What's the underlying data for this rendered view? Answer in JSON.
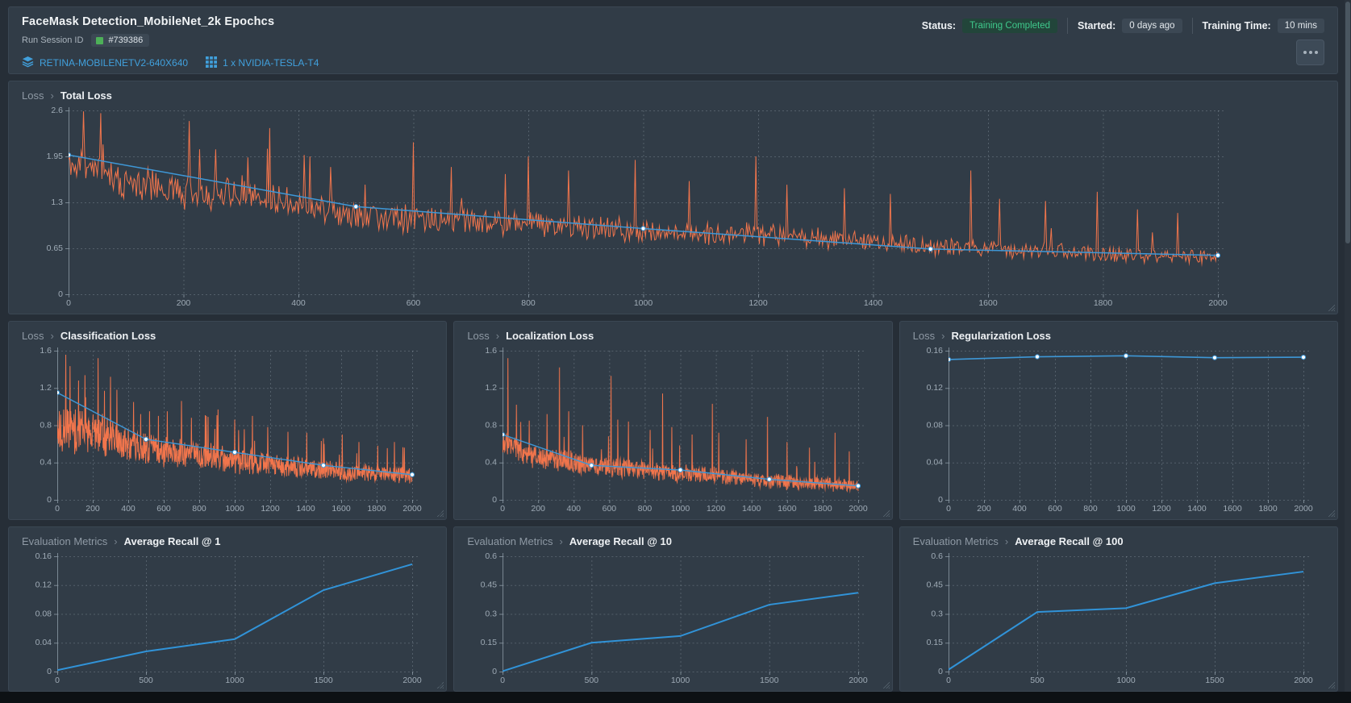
{
  "header": {
    "title": "FaceMask Detection_MobileNet_2k Epochcs",
    "run_session_label": "Run Session ID",
    "run_session_id": "#739386",
    "model_link": "RETINA-MOBILENETV2-640X640",
    "gpu_link": "1 x NVIDIA-TESLA-T4",
    "status_label": "Status:",
    "status_value": "Training Completed",
    "started_label": "Started:",
    "started_value": "0 days ago",
    "training_time_label": "Training Time:",
    "training_time_value": "10 mins"
  },
  "ui": {
    "breadcrumb_separator": "›",
    "colors": {
      "accent_blue": "#41A0DC",
      "raw_orange": "#F1754C",
      "smoothed_blue": "#3E97D6",
      "status_green": "#3FC98C",
      "status_green_bg": "#22453A",
      "badge_bg": "#3C4854",
      "panel_bg": "#313C47",
      "page_bg": "#262E37"
    }
  },
  "chart_data": [
    {
      "id": "total-loss",
      "group": "Loss",
      "title": "Total Loss",
      "type": "line",
      "x_range": [
        0,
        2000
      ],
      "y_range": [
        0,
        2.6
      ],
      "x_ticks": [
        0,
        200,
        400,
        600,
        800,
        1000,
        1200,
        1400,
        1600,
        1800,
        2000
      ],
      "y_ticks": [
        0,
        0.65,
        1.3,
        1.95,
        2.6
      ],
      "raw": {
        "color": "#F1754C",
        "seed": 11,
        "samples": 1000,
        "trend_x": [
          0,
          100,
          200,
          300,
          400,
          500,
          600,
          700,
          800,
          900,
          1000,
          1100,
          1200,
          1300,
          1400,
          1500,
          1600,
          1700,
          1800,
          1900,
          2000
        ],
        "trend_y": [
          1.9,
          1.58,
          1.46,
          1.44,
          1.3,
          1.12,
          1.06,
          1.02,
          1.0,
          0.94,
          0.9,
          0.86,
          0.84,
          0.8,
          0.73,
          0.68,
          0.63,
          0.62,
          0.58,
          0.55,
          0.52
        ],
        "amp": [
          0.3,
          0.28,
          0.28,
          0.3,
          0.26,
          0.22,
          0.22,
          0.22,
          0.2,
          0.2,
          0.18,
          0.18,
          0.18,
          0.16,
          0.16,
          0.15,
          0.14,
          0.14,
          0.13,
          0.13,
          0.12
        ],
        "spikes": [
          [
            25,
            2.6
          ],
          [
            60,
            2.12
          ],
          [
            210,
            2.45
          ],
          [
            255,
            2.05
          ],
          [
            350,
            2.35
          ],
          [
            420,
            1.95
          ],
          [
            455,
            1.8
          ],
          [
            600,
            2.15
          ],
          [
            665,
            1.8
          ],
          [
            760,
            1.7
          ],
          [
            800,
            1.95
          ],
          [
            870,
            1.75
          ],
          [
            985,
            1.9
          ],
          [
            1080,
            1.6
          ],
          [
            1195,
            1.95
          ],
          [
            1250,
            1.55
          ],
          [
            1350,
            1.5
          ],
          [
            1430,
            1.42
          ],
          [
            1570,
            1.75
          ],
          [
            1620,
            1.35
          ],
          [
            1700,
            1.32
          ],
          [
            1790,
            1.45
          ],
          [
            1860,
            1.2
          ],
          [
            1930,
            1.15
          ]
        ]
      },
      "smoothed": {
        "color": "#3E97D6",
        "width": 1.5,
        "dots": true,
        "x": [
          0,
          500,
          1000,
          1500,
          2000
        ],
        "y": [
          1.97,
          1.24,
          0.93,
          0.64,
          0.55
        ]
      }
    },
    {
      "id": "classification-loss",
      "group": "Loss",
      "title": "Classification Loss",
      "type": "line",
      "x_range": [
        0,
        2000
      ],
      "y_range": [
        0,
        1.6
      ],
      "x_ticks": [
        0,
        200,
        400,
        600,
        800,
        1000,
        1200,
        1400,
        1600,
        1800,
        2000
      ],
      "y_ticks": [
        0,
        0.4,
        0.8,
        1.2,
        1.6
      ],
      "raw": {
        "color": "#F1754C",
        "seed": 22,
        "samples": 1000,
        "trend_x": [
          0,
          100,
          200,
          300,
          400,
          500,
          600,
          700,
          800,
          900,
          1000,
          1100,
          1200,
          1300,
          1400,
          1500,
          1600,
          1700,
          1800,
          1900,
          2000
        ],
        "trend_y": [
          0.8,
          0.74,
          0.71,
          0.67,
          0.6,
          0.55,
          0.52,
          0.5,
          0.48,
          0.45,
          0.42,
          0.4,
          0.38,
          0.36,
          0.34,
          0.32,
          0.3,
          0.29,
          0.28,
          0.27,
          0.26
        ],
        "amp": [
          0.34,
          0.29,
          0.27,
          0.25,
          0.22,
          0.2,
          0.18,
          0.17,
          0.16,
          0.15,
          0.15,
          0.14,
          0.14,
          0.13,
          0.13,
          0.12,
          0.12,
          0.11,
          0.11,
          0.1,
          0.1
        ],
        "spikes": [
          [
            120,
            1.28
          ],
          [
            160,
            1.1
          ],
          [
            230,
            1.52
          ],
          [
            300,
            1.32
          ],
          [
            335,
            1.18
          ],
          [
            430,
            1.05
          ],
          [
            470,
            0.92
          ],
          [
            520,
            0.95
          ],
          [
            570,
            0.9
          ],
          [
            620,
            0.95
          ],
          [
            700,
            1.06
          ],
          [
            755,
            0.88
          ],
          [
            840,
            0.9
          ],
          [
            905,
            0.97
          ],
          [
            1000,
            0.86
          ],
          [
            1100,
            0.9
          ],
          [
            1185,
            0.78
          ],
          [
            1300,
            0.73
          ],
          [
            1405,
            0.72
          ],
          [
            1500,
            0.66
          ],
          [
            1605,
            0.7
          ],
          [
            1700,
            0.62
          ],
          [
            1805,
            0.58
          ],
          [
            1900,
            0.62
          ],
          [
            1955,
            0.56
          ]
        ]
      },
      "smoothed": {
        "color": "#3E97D6",
        "width": 1.4,
        "dots": true,
        "x": [
          0,
          500,
          1000,
          1500,
          2000
        ],
        "y": [
          1.15,
          0.65,
          0.51,
          0.37,
          0.27
        ]
      }
    },
    {
      "id": "localization-loss",
      "group": "Loss",
      "title": "Localization Loss",
      "type": "line",
      "x_range": [
        0,
        2000
      ],
      "y_range": [
        0,
        1.6
      ],
      "x_ticks": [
        0,
        200,
        400,
        600,
        800,
        1000,
        1200,
        1400,
        1600,
        1800,
        2000
      ],
      "y_ticks": [
        0,
        0.4,
        0.8,
        1.2,
        1.6
      ],
      "raw": {
        "color": "#F1754C",
        "seed": 33,
        "samples": 1000,
        "trend_x": [
          0,
          100,
          200,
          300,
          400,
          500,
          600,
          700,
          800,
          900,
          1000,
          1100,
          1200,
          1300,
          1400,
          1500,
          1600,
          1700,
          1800,
          1900,
          2000
        ],
        "trend_y": [
          0.62,
          0.5,
          0.45,
          0.42,
          0.4,
          0.37,
          0.35,
          0.33,
          0.32,
          0.3,
          0.28,
          0.27,
          0.26,
          0.24,
          0.22,
          0.2,
          0.19,
          0.18,
          0.17,
          0.16,
          0.15
        ],
        "amp": [
          0.15,
          0.14,
          0.14,
          0.13,
          0.13,
          0.12,
          0.12,
          0.12,
          0.11,
          0.11,
          0.11,
          0.1,
          0.1,
          0.1,
          0.09,
          0.09,
          0.09,
          0.08,
          0.08,
          0.08,
          0.08
        ],
        "spikes": [
          [
            30,
            1.52
          ],
          [
            78,
            1.02
          ],
          [
            150,
            0.85
          ],
          [
            250,
            0.92
          ],
          [
            320,
            1.42
          ],
          [
            372,
            0.95
          ],
          [
            450,
            0.8
          ],
          [
            610,
            1.33
          ],
          [
            648,
            0.86
          ],
          [
            708,
            0.84
          ],
          [
            830,
            0.75
          ],
          [
            900,
            1.14
          ],
          [
            952,
            0.78
          ],
          [
            1065,
            0.7
          ],
          [
            1180,
            1.03
          ],
          [
            1215,
            0.72
          ],
          [
            1370,
            0.65
          ],
          [
            1490,
            0.89
          ],
          [
            1600,
            0.62
          ],
          [
            1725,
            0.56
          ],
          [
            1870,
            0.72
          ],
          [
            1950,
            0.52
          ]
        ]
      },
      "smoothed": {
        "color": "#3E97D6",
        "width": 1.4,
        "dots": true,
        "x": [
          0,
          500,
          1000,
          1500,
          2000
        ],
        "y": [
          0.7,
          0.37,
          0.32,
          0.22,
          0.15
        ]
      }
    },
    {
      "id": "regularization-loss",
      "group": "Loss",
      "title": "Regularization Loss",
      "type": "line",
      "x_range": [
        0,
        2000
      ],
      "y_range": [
        0,
        0.16
      ],
      "x_ticks": [
        0,
        200,
        400,
        600,
        800,
        1000,
        1200,
        1400,
        1600,
        1800,
        2000
      ],
      "y_ticks": [
        0,
        0.04,
        0.08,
        0.12,
        0.16
      ],
      "smoothed": {
        "color": "#3E97D6",
        "width": 1.6,
        "dots": true,
        "x": [
          0,
          500,
          1000,
          1500,
          2000
        ],
        "y": [
          0.1505,
          0.1535,
          0.1545,
          0.1525,
          0.153
        ]
      }
    },
    {
      "id": "average-recall-1",
      "group": "Evaluation Metrics",
      "title": "Average Recall @ 1",
      "type": "line",
      "x_range": [
        0,
        2000
      ],
      "y_range": [
        0,
        0.16
      ],
      "x_ticks": [
        0,
        500,
        1000,
        1500,
        2000
      ],
      "y_ticks": [
        0,
        0.04,
        0.08,
        0.12,
        0.16
      ],
      "smoothed": {
        "color": "#3193D8",
        "width": 2,
        "dots": false,
        "x": [
          0,
          500,
          1000,
          1500,
          2000
        ],
        "y": [
          0.002,
          0.028,
          0.045,
          0.113,
          0.149
        ]
      }
    },
    {
      "id": "average-recall-10",
      "group": "Evaluation Metrics",
      "title": "Average Recall @ 10",
      "type": "line",
      "x_range": [
        0,
        2000
      ],
      "y_range": [
        0,
        0.6
      ],
      "x_ticks": [
        0,
        500,
        1000,
        1500,
        2000
      ],
      "y_ticks": [
        0,
        0.15,
        0.3,
        0.45,
        0.6
      ],
      "smoothed": {
        "color": "#3193D8",
        "width": 2,
        "dots": false,
        "x": [
          0,
          500,
          1000,
          1500,
          2000
        ],
        "y": [
          0.002,
          0.15,
          0.185,
          0.348,
          0.41
        ]
      }
    },
    {
      "id": "average-recall-100",
      "group": "Evaluation Metrics",
      "title": "Average Recall @ 100",
      "type": "line",
      "x_range": [
        0,
        2000
      ],
      "y_range": [
        0,
        0.6
      ],
      "x_ticks": [
        0,
        500,
        1000,
        1500,
        2000
      ],
      "y_ticks": [
        0,
        0.15,
        0.3,
        0.45,
        0.6
      ],
      "smoothed": {
        "color": "#3193D8",
        "width": 2,
        "dots": false,
        "x": [
          0,
          500,
          1000,
          1500,
          2000
        ],
        "y": [
          0.01,
          0.31,
          0.33,
          0.46,
          0.52
        ]
      }
    }
  ]
}
